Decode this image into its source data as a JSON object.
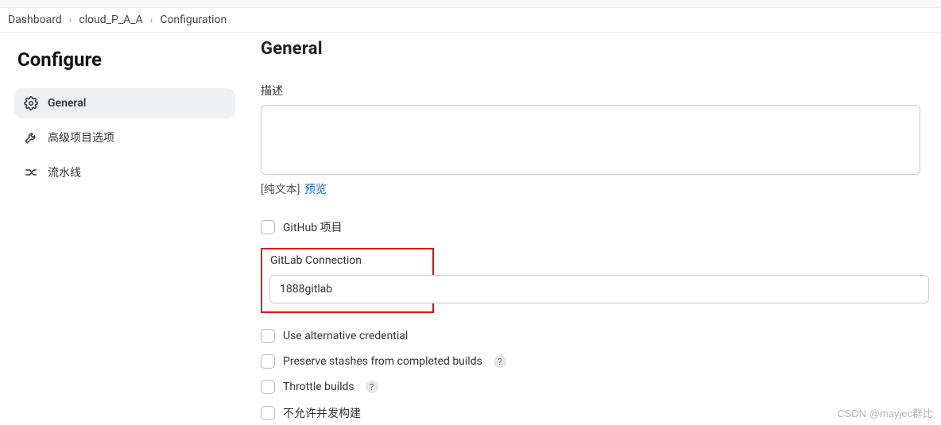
{
  "breadcrumb": {
    "items": [
      "Dashboard",
      "cloud_P_A_A",
      "Configuration"
    ]
  },
  "page_title": "Configure",
  "sidebar": {
    "items": [
      {
        "label": "General",
        "icon": "gear-icon",
        "active": true
      },
      {
        "label": "高级项目选项",
        "icon": "wrench-icon",
        "active": false
      },
      {
        "label": "流水线",
        "icon": "pipeline-icon",
        "active": false
      }
    ]
  },
  "main": {
    "section_title": "General",
    "description_label": "描述",
    "description_value": "",
    "hint_plain": "[纯文本]",
    "hint_link": "预览",
    "checkboxes": {
      "github_project": "GitHub 项目",
      "use_alt_cred": "Use alternative credential",
      "preserve_stashes": "Preserve stashes from completed builds",
      "throttle_builds": "Throttle builds",
      "no_concurrent": "不允许并发构建"
    },
    "gitlab_connection": {
      "label": "GitLab Connection",
      "value": "1888gitlab"
    },
    "help_glyph": "?"
  },
  "watermark": "CSDN @mayjec群比"
}
